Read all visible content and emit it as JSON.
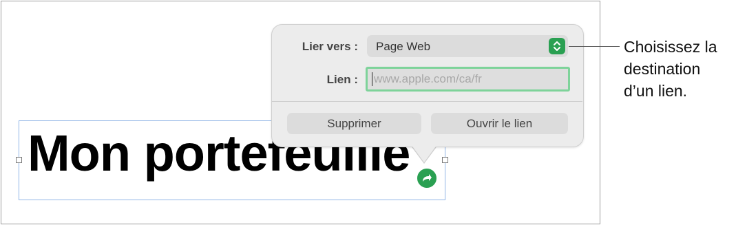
{
  "document": {
    "title_text": "Mon portefeuille"
  },
  "link_popover": {
    "link_to_label": "Lier vers :",
    "link_to_value": "Page Web",
    "link_label": "Lien :",
    "link_placeholder": "www.apple.com/ca/fr",
    "delete_button": "Supprimer",
    "open_button": "Ouvrir le lien"
  },
  "callout": {
    "line1": "Choisissez la",
    "line2": "destination",
    "line3": "d’un lien."
  },
  "colors": {
    "accent_green": "#2aa052",
    "focus_ring": "#7ed39a",
    "selection_border": "#8fb4e6"
  },
  "icons": {
    "link_badge": "link-arrow-icon",
    "stepper": "up-down-chevron-icon"
  }
}
